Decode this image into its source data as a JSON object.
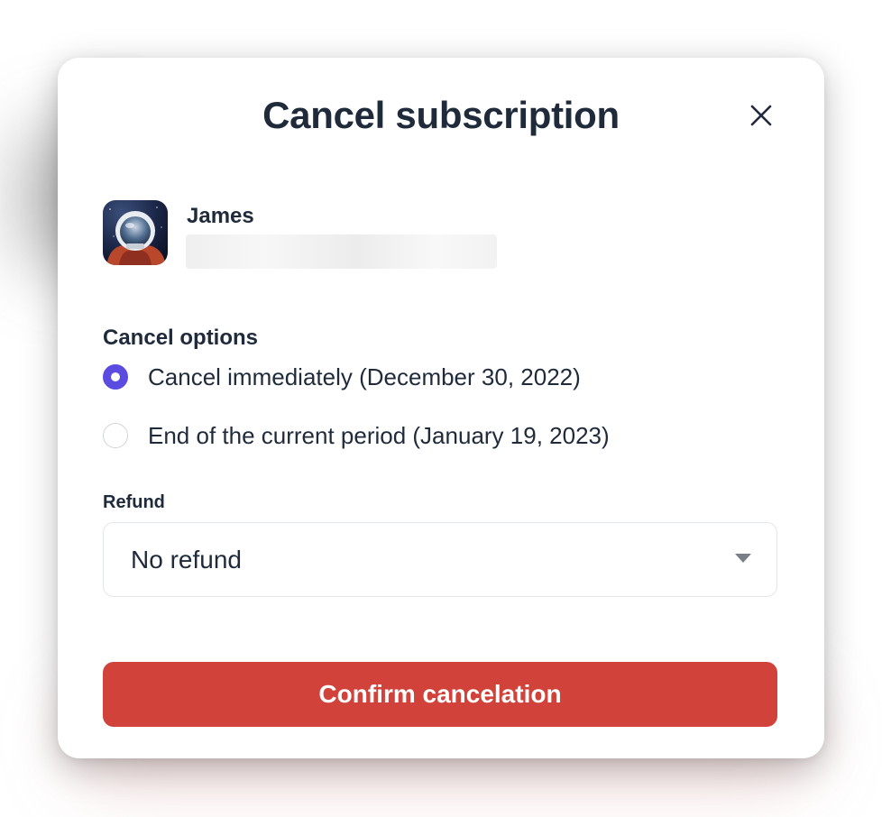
{
  "dialog": {
    "title": "Cancel subscription",
    "close_icon": "close-icon"
  },
  "customer": {
    "name": "James",
    "avatar_icon": "astronaut-avatar"
  },
  "cancel_options": {
    "label": "Cancel options",
    "options": [
      {
        "label": "Cancel immediately (December 30, 2022)",
        "selected": true
      },
      {
        "label": "End of the current period (January 19, 2023)",
        "selected": false
      }
    ]
  },
  "refund": {
    "label": "Refund",
    "selected_value": "No refund"
  },
  "actions": {
    "confirm_label": "Confirm cancelation"
  },
  "colors": {
    "accent": "#5b4be1",
    "danger": "#d0423a",
    "text": "#1f2a3a"
  }
}
